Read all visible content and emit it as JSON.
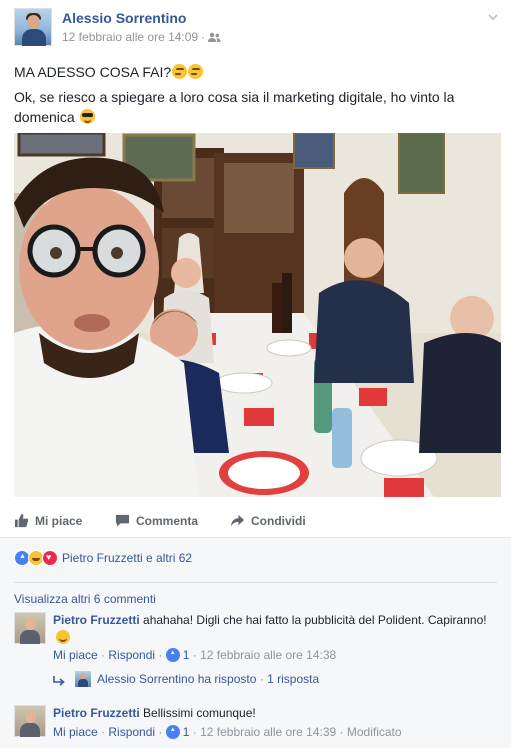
{
  "post": {
    "author": "Alessio Sorrentino",
    "timestamp": "12 febbraio alle ore 14:09",
    "audience_icon": "friends-icon",
    "line1": "MA ADESSO COSA FAI?",
    "line1_emoji": "thinking-face-emoji",
    "line2": "Ok, se riesco a spiegare a loro cosa sia il marketing digitale, ho vinto la domenica",
    "line2_emoji": "sunglasses-emoji",
    "photo_alt": "Selfie at a family dinner table"
  },
  "actions": {
    "like": "Mi piace",
    "comment": "Commenta",
    "share": "Condividi"
  },
  "reactions": {
    "types": [
      "like",
      "haha",
      "love"
    ],
    "summary": "Pietro Fruzzetti e altri 62"
  },
  "comments": {
    "view_more": "Visualizza altri 6 commenti",
    "items": [
      {
        "author": "Pietro Fruzzetti",
        "text": "ahahaha! Digli che hai fatto la pubblicità del Polident. Capiranno!",
        "like_label": "Mi piace",
        "reply_label": "Rispondi",
        "likes": "1",
        "time": "12 febbraio alle ore 14:38",
        "edited": ""
      },
      {
        "author": "Pietro Fruzzetti",
        "text": "Bellissimi comunque!",
        "like_label": "Mi piace",
        "reply_label": "Rispondi",
        "likes": "1",
        "time": "12 febbraio alle ore 14:39",
        "edited": "Modificato"
      }
    ],
    "reply_summary": {
      "author_action": "Alessio Sorrentino ha risposto",
      "count": "1 risposta"
    }
  },
  "colors": {
    "link": "#365899",
    "meta": "#90949c",
    "action": "#616770",
    "comment_bg": "#f6f7f9"
  }
}
